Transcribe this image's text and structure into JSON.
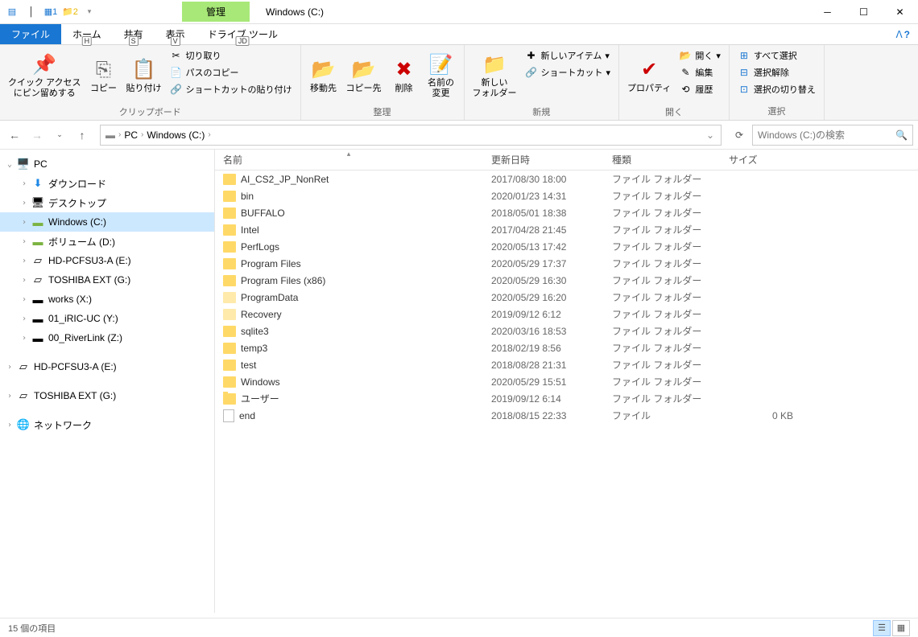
{
  "title": "Windows (C:)",
  "contextual_tab": "管理",
  "ribbon_tabs": {
    "file": "ファイル",
    "home": {
      "label": "ホーム",
      "badge": "H"
    },
    "share": {
      "label": "共有",
      "badge": "S"
    },
    "view": {
      "label": "表示",
      "badge": "V"
    },
    "drive": {
      "label": "ドライブ ツール",
      "badge": "JD"
    }
  },
  "qat_badges": {
    "one": "1",
    "two": "2"
  },
  "ribbon": {
    "group_clipboard": "クリップボード",
    "group_organize": "整理",
    "group_new": "新規",
    "group_open": "開く",
    "group_select": "選択",
    "pin": "クイック アクセス\nにピン留めする",
    "copy": "コピー",
    "paste": "貼り付け",
    "cut": "切り取り",
    "copy_path": "パスのコピー",
    "paste_shortcut": "ショートカットの貼り付け",
    "move_to": "移動先",
    "copy_to": "コピー先",
    "delete": "削除",
    "rename": "名前の\n変更",
    "new_folder": "新しい\nフォルダー",
    "new_item": "新しいアイテム",
    "shortcut": "ショートカット",
    "properties": "プロパティ",
    "open": "開く",
    "edit": "編集",
    "history": "履歴",
    "select_all": "すべて選択",
    "select_none": "選択解除",
    "invert": "選択の切り替え"
  },
  "breadcrumbs": {
    "pc": "PC",
    "drive": "Windows (C:)"
  },
  "search_placeholder": "Windows (C:)の検索",
  "tree": [
    {
      "indent": 0,
      "icon": "pc",
      "label": "PC",
      "exp": "v"
    },
    {
      "indent": 1,
      "icon": "dl",
      "label": "ダウンロード",
      "exp": ">"
    },
    {
      "indent": 1,
      "icon": "desk",
      "label": "デスクトップ",
      "exp": ">"
    },
    {
      "indent": 1,
      "icon": "drive",
      "label": "Windows (C:)",
      "exp": ">",
      "selected": true
    },
    {
      "indent": 1,
      "icon": "drive",
      "label": "ボリューム (D:)",
      "exp": ">"
    },
    {
      "indent": 1,
      "icon": "hdd",
      "label": "HD-PCFSU3-A (E:)",
      "exp": ">"
    },
    {
      "indent": 1,
      "icon": "hdd",
      "label": "TOSHIBA EXT (G:)",
      "exp": ">"
    },
    {
      "indent": 1,
      "icon": "net",
      "label": "works (X:)",
      "exp": ">"
    },
    {
      "indent": 1,
      "icon": "net",
      "label": "01_iRIC-UC (Y:)",
      "exp": ">"
    },
    {
      "indent": 1,
      "icon": "net",
      "label": "00_RiverLink (Z:)",
      "exp": ">"
    },
    {
      "spacer": true
    },
    {
      "indent": 0,
      "icon": "hdd",
      "label": "HD-PCFSU3-A (E:)",
      "exp": ">"
    },
    {
      "spacer": true
    },
    {
      "indent": 0,
      "icon": "hdd",
      "label": "TOSHIBA EXT (G:)",
      "exp": ">"
    },
    {
      "spacer": true
    },
    {
      "indent": 0,
      "icon": "netw",
      "label": "ネットワーク",
      "exp": ">"
    }
  ],
  "columns": {
    "name": "名前",
    "date": "更新日時",
    "type": "種類",
    "size": "サイズ"
  },
  "files": [
    {
      "icon": "folder",
      "name": "AI_CS2_JP_NonRet",
      "date": "2017/08/30 18:00",
      "type": "ファイル フォルダー",
      "size": ""
    },
    {
      "icon": "folder",
      "name": "bin",
      "date": "2020/01/23 14:31",
      "type": "ファイル フォルダー",
      "size": ""
    },
    {
      "icon": "folder",
      "name": "BUFFALO",
      "date": "2018/05/01 18:38",
      "type": "ファイル フォルダー",
      "size": ""
    },
    {
      "icon": "folder",
      "name": "Intel",
      "date": "2017/04/28 21:45",
      "type": "ファイル フォルダー",
      "size": ""
    },
    {
      "icon": "folder",
      "name": "PerfLogs",
      "date": "2020/05/13 17:42",
      "type": "ファイル フォルダー",
      "size": ""
    },
    {
      "icon": "folder",
      "name": "Program Files",
      "date": "2020/05/29 17:37",
      "type": "ファイル フォルダー",
      "size": ""
    },
    {
      "icon": "folder",
      "name": "Program Files (x86)",
      "date": "2020/05/29 16:30",
      "type": "ファイル フォルダー",
      "size": ""
    },
    {
      "icon": "folder-hidden",
      "name": "ProgramData",
      "date": "2020/05/29 16:20",
      "type": "ファイル フォルダー",
      "size": ""
    },
    {
      "icon": "folder-hidden",
      "name": "Recovery",
      "date": "2019/09/12 6:12",
      "type": "ファイル フォルダー",
      "size": ""
    },
    {
      "icon": "folder",
      "name": "sqlite3",
      "date": "2020/03/16 18:53",
      "type": "ファイル フォルダー",
      "size": ""
    },
    {
      "icon": "folder",
      "name": "temp3",
      "date": "2018/02/19 8:56",
      "type": "ファイル フォルダー",
      "size": ""
    },
    {
      "icon": "folder",
      "name": "test",
      "date": "2018/08/28 21:31",
      "type": "ファイル フォルダー",
      "size": ""
    },
    {
      "icon": "folder",
      "name": "Windows",
      "date": "2020/05/29 15:51",
      "type": "ファイル フォルダー",
      "size": ""
    },
    {
      "icon": "folder",
      "name": "ユーザー",
      "date": "2019/09/12 6:14",
      "type": "ファイル フォルダー",
      "size": ""
    },
    {
      "icon": "file",
      "name": "end",
      "date": "2018/08/15 22:33",
      "type": "ファイル",
      "size": "0 KB"
    }
  ],
  "status": "15 個の項目"
}
